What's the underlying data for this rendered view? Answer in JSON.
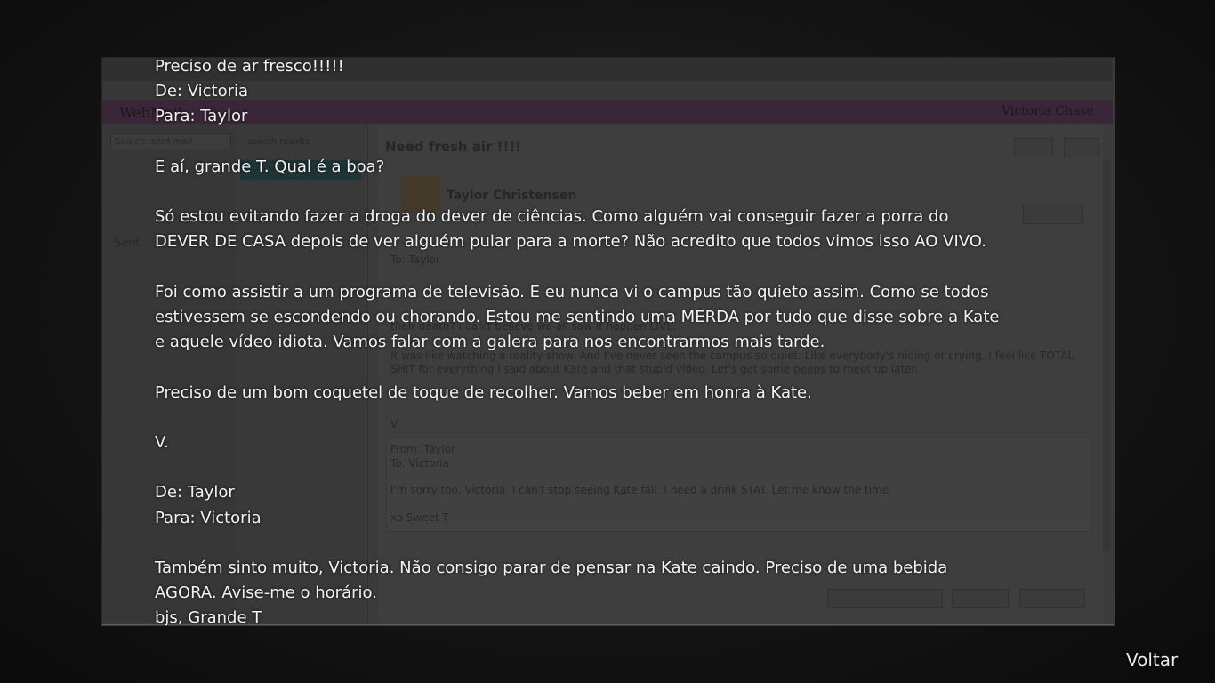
{
  "background_window": {
    "brand": "WebMail",
    "user": "Victoria Chase",
    "search_placeholder": "Search: sent mail",
    "search_results": "search results",
    "folder_label": "Sent",
    "subject": "Need fresh air !!!!",
    "sender": "Taylor Christensen",
    "lines": [
      "To: Taylor",
      "their death? I can't believe we all saw it happen LIVE.",
      "It was like watching a reality show. And I've never seen the campus so quiet. Like everybody's hiding or crying. I feel like TOTAL",
      "SHIT for everything I said about Kate and that stupid video. Let's get some peeps to meet up later.",
      "V.",
      "From: Taylor",
      "To: Victoria",
      "I'm sorry too, Victoria. I can't stop seeing Kate fall. I need a drink STAT. Let me know the time.",
      "xo Sweet-T"
    ]
  },
  "mail": {
    "subject": "Preciso de ar fresco!!!!!",
    "from_1": "De: Victoria",
    "to_1": "Para: Taylor",
    "p1": "E aí, grande T. Qual é a boa?",
    "p2_l1": "Só estou evitando fazer a droga do dever de ciências. Como alguém vai conseguir fazer a porra do",
    "p2_l2": "DEVER DE CASA depois de ver alguém pular para a morte? Não acredito que todos vimos isso AO VIVO.",
    "p3_l1": "Foi como assistir a um programa de televisão. E eu nunca vi o campus tão quieto assim. Como se todos",
    "p3_l2": "estivessem se escondendo ou chorando. Estou me sentindo uma MERDA por tudo que disse sobre a Kate",
    "p3_l3": "e aquele vídeo idiota. Vamos falar com a galera para nos encontrarmos mais tarde.",
    "p4": "Preciso de um bom coquetel de toque de recolher. Vamos beber em honra à Kate.",
    "sign_1": "V.",
    "from_2": "De: Taylor",
    "to_2": "Para: Victoria",
    "p5_l1": "Também sinto muito, Victoria. Não consigo parar de pensar na Kate caindo. Preciso de uma bebida",
    "p5_l2": "AGORA. Avise-me o horário.",
    "sign_2": "bjs, Grande T"
  },
  "back_label": "Voltar"
}
